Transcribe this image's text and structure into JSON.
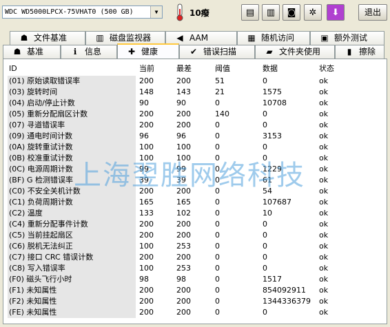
{
  "toolbar": {
    "drive": "WDC WD5000LPCX-75VHAT0 (500 GB)",
    "temperature": "10癈",
    "exit_label": "退出",
    "buttons": [
      {
        "name": "copy-icon",
        "glyph": "▤"
      },
      {
        "name": "copy-all-icon",
        "glyph": "▥"
      },
      {
        "name": "camera-icon",
        "glyph": "◙"
      },
      {
        "name": "tools-icon",
        "glyph": "✲"
      },
      {
        "name": "down-arrow-icon",
        "glyph": "⬇"
      }
    ]
  },
  "tabs_top": [
    {
      "label": "文件基准",
      "icon": "file-benchmark-icon",
      "glyph": "☗"
    },
    {
      "label": "磁盘监视器",
      "icon": "disk-monitor-icon",
      "glyph": "▥"
    },
    {
      "label": "AAM",
      "icon": "speaker-icon",
      "glyph": "◀"
    },
    {
      "label": "随机访问",
      "icon": "random-access-icon",
      "glyph": "▦"
    },
    {
      "label": "额外测试",
      "icon": "extra-tests-icon",
      "glyph": "▣"
    }
  ],
  "tabs_bottom": [
    {
      "label": "基准",
      "icon": "benchmark-icon",
      "glyph": "☗"
    },
    {
      "label": "信息",
      "icon": "info-icon",
      "glyph": "ℹ"
    },
    {
      "label": "健康",
      "icon": "health-cross-icon",
      "glyph": "✚"
    },
    {
      "label": "错误扫描",
      "icon": "error-scan-icon",
      "glyph": "✔"
    },
    {
      "label": "文件夹使用",
      "icon": "folder-icon",
      "glyph": "▰"
    },
    {
      "label": "擦除",
      "icon": "trash-icon",
      "glyph": "▮"
    }
  ],
  "table": {
    "headers": {
      "id": "ID",
      "current": "当前",
      "worst": "最差",
      "threshold": "阈值",
      "data": "数据",
      "status": "状态"
    },
    "rows": [
      [
        "(01) 原始读取错误率",
        "200",
        "200",
        "51",
        "0",
        "ok"
      ],
      [
        "(03) 旋转时间",
        "148",
        "143",
        "21",
        "1575",
        "ok"
      ],
      [
        "(04) 启动/停止计数",
        "90",
        "90",
        "0",
        "10708",
        "ok"
      ],
      [
        "(05) 重新分配扇区计数",
        "200",
        "200",
        "140",
        "0",
        "ok"
      ],
      [
        "(07) 寻道错误率",
        "200",
        "200",
        "0",
        "0",
        "ok"
      ],
      [
        "(09) 通电时间计数",
        "96",
        "96",
        "0",
        "3153",
        "ok"
      ],
      [
        "(0A) 旋转重试计数",
        "100",
        "100",
        "0",
        "0",
        "ok"
      ],
      [
        "(0B) 校准重试计数",
        "100",
        "100",
        "0",
        "0",
        "ok"
      ],
      [
        "(0C) 电源周期计数",
        "99",
        "99",
        "0",
        "1229",
        "ok"
      ],
      [
        "(BF) G 检测错误率",
        "39",
        "39",
        "0",
        "61",
        "ok"
      ],
      [
        "(C0) 不安全关机计数",
        "200",
        "200",
        "0",
        "54",
        "ok"
      ],
      [
        "(C1) 负荷周期计数",
        "165",
        "165",
        "0",
        "107687",
        "ok"
      ],
      [
        "(C2) 温度",
        "133",
        "102",
        "0",
        "10",
        "ok"
      ],
      [
        "(C4) 重新分配事件计数",
        "200",
        "200",
        "0",
        "0",
        "ok"
      ],
      [
        "(C5) 当前挂起扇区",
        "200",
        "200",
        "0",
        "0",
        "ok"
      ],
      [
        "(C6) 脱机无法纠正",
        "100",
        "253",
        "0",
        "0",
        "ok"
      ],
      [
        "(C7) 接口 CRC 错误计数",
        "200",
        "200",
        "0",
        "0",
        "ok"
      ],
      [
        "(C8) 写入错误率",
        "100",
        "253",
        "0",
        "0",
        "ok"
      ],
      [
        "(F0) 磁头飞行小时",
        "98",
        "98",
        "0",
        "1517",
        "ok"
      ],
      [
        "(F1) 未知属性",
        "200",
        "200",
        "0",
        "854092911",
        "ok"
      ],
      [
        "(F2) 未知属性",
        "200",
        "200",
        "0",
        "1344336379",
        "ok"
      ],
      [
        "(FE) 未知属性",
        "200",
        "200",
        "0",
        "0",
        "ok"
      ]
    ]
  },
  "watermark": "上海翌胜网络科技"
}
